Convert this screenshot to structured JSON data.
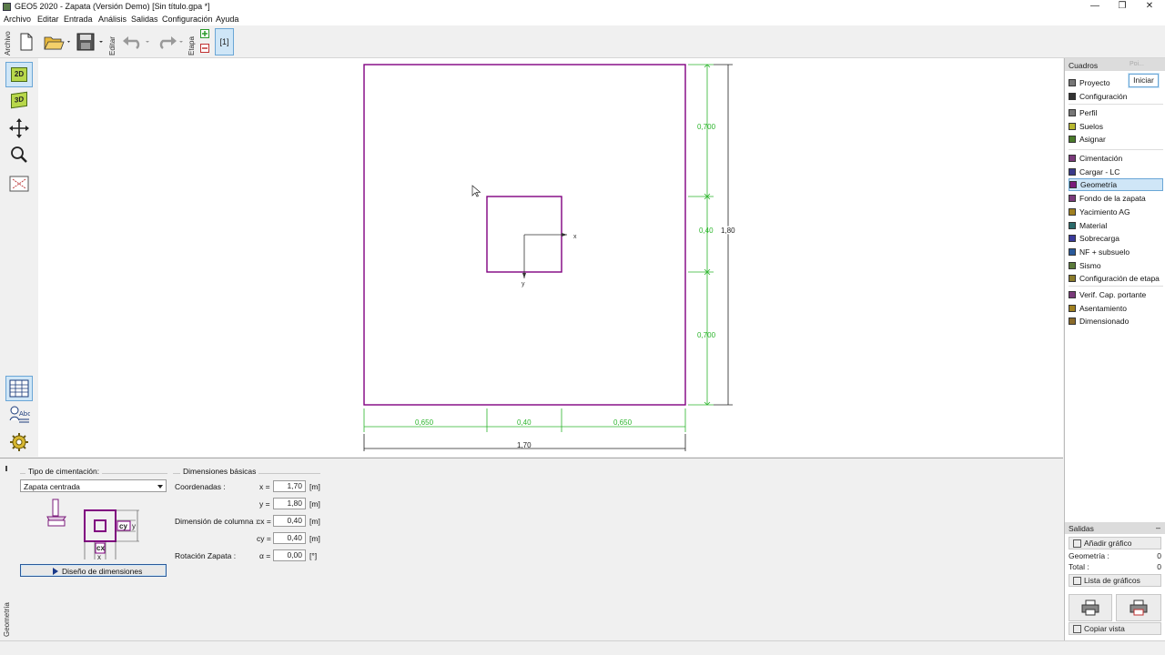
{
  "window": {
    "title": "GEO5 2020 - Zapata (Versión Demo) [Sin título.gpa *]",
    "minimize": "—",
    "restore": "❐",
    "close": "✕"
  },
  "menu": [
    "Archivo",
    "Editar",
    "Entrada",
    "Análisis",
    "Salidas",
    "Configuración",
    "Ayuda"
  ],
  "toolbar": {
    "archivo_label": "Archivo",
    "editar_label": "Editar",
    "etapa_label": "Etapa",
    "stage_button": "[1]",
    "icons": [
      "new-file-icon",
      "open-folder-icon",
      "save-icon",
      "undo-icon",
      "redo-icon",
      "add-stage-icon",
      "remove-stage-icon"
    ]
  },
  "left_tools": {
    "view2d": "2D",
    "view3d": "3D"
  },
  "drawing": {
    "dims_right": [
      "0,700",
      "0,40",
      "0,700"
    ],
    "dim_total_y": "1,80",
    "dims_bottom": [
      "0,650",
      "0,40",
      "0,650"
    ],
    "dim_total_x": "1,70",
    "axis_x": "x",
    "axis_y": "y",
    "colors": {
      "footing": "#800080",
      "dimension": "#2db52d",
      "dimension_total": "#222222"
    }
  },
  "right_panel": {
    "header": "Cuadros",
    "header_hint": "Poi...",
    "start_button": "Iniciar",
    "groups": [
      [
        {
          "label": "Proyecto",
          "icon": "project-icon",
          "color": "#777777"
        },
        {
          "label": "Configuración",
          "icon": "settings-gear-icon",
          "color": "#333333"
        }
      ],
      [
        {
          "label": "Perfil",
          "icon": "profile-icon",
          "color": "#777777"
        },
        {
          "label": "Suelos",
          "icon": "soils-icon",
          "color": "#b8b830"
        },
        {
          "label": "Asignar",
          "icon": "assign-icon",
          "color": "#4a7a2a"
        }
      ],
      [
        {
          "label": "Cimentación",
          "icon": "foundation-icon",
          "color": "#7a3a7a"
        },
        {
          "label": "Cargar - LC",
          "icon": "load-icon",
          "color": "#3a3a8a"
        },
        {
          "label": "Geometría",
          "icon": "geometry-icon",
          "color": "#7a1a7a",
          "selected": true
        },
        {
          "label": "Fondo de la zapata",
          "icon": "footing-bottom-icon",
          "color": "#7a3a7a"
        },
        {
          "label": "Yacimiento AG",
          "icon": "sand-bed-icon",
          "color": "#a08020"
        },
        {
          "label": "Material",
          "icon": "material-icon",
          "color": "#2a6a6a"
        },
        {
          "label": "Sobrecarga",
          "icon": "surcharge-icon",
          "color": "#3a3a9a"
        },
        {
          "label": "NF + subsuelo",
          "icon": "water-table-icon",
          "color": "#2a5a9a"
        },
        {
          "label": "Sismo",
          "icon": "earthquake-icon",
          "color": "#5a7a3a"
        },
        {
          "label": "Configuración de etapa",
          "icon": "stage-settings-icon",
          "color": "#8a7a2a"
        }
      ],
      [
        {
          "label": "Verif. Cap. portante",
          "icon": "bearing-capacity-icon",
          "color": "#7a3a7a"
        },
        {
          "label": "Asentamiento",
          "icon": "settlement-icon",
          "color": "#a08020"
        },
        {
          "label": "Dimensionado",
          "icon": "dimensioning-icon",
          "color": "#8a6a2a"
        }
      ]
    ],
    "outputs": {
      "header": "Salidas",
      "collapse": "–",
      "add_chart": "Añadir gráfico",
      "geometry_label": "Geometría :",
      "geometry_count": "0",
      "total_label": "Total :",
      "total_count": "0",
      "chart_list": "Lista de gráficos",
      "copy_view": "Copiar vista"
    }
  },
  "bottom_panel": {
    "vertical_tab": "Geometría",
    "foundation_type_title": "Tipo de cimentación:",
    "foundation_type_value": "Zapata centrada",
    "design_button": "Diseño de dimensiones",
    "basic_dims_title": "Dimensiones básicas",
    "rows": [
      {
        "label": "Coordenadas :",
        "var": "x =",
        "value": "1,70",
        "unit": "[m]"
      },
      {
        "label": "",
        "var": "y =",
        "value": "1,80",
        "unit": "[m]"
      },
      {
        "label": "Dimensión de columna :",
        "var": "cx =",
        "value": "0,40",
        "unit": "[m]"
      },
      {
        "label": "",
        "var": "cy =",
        "value": "0,40",
        "unit": "[m]"
      },
      {
        "label": "Rotación Zapata :",
        "var": "α =",
        "value": "0,00",
        "unit": "[°]"
      }
    ],
    "sketch": {
      "cx": "cx",
      "cy": "cy",
      "x": "x",
      "y": "y"
    }
  }
}
